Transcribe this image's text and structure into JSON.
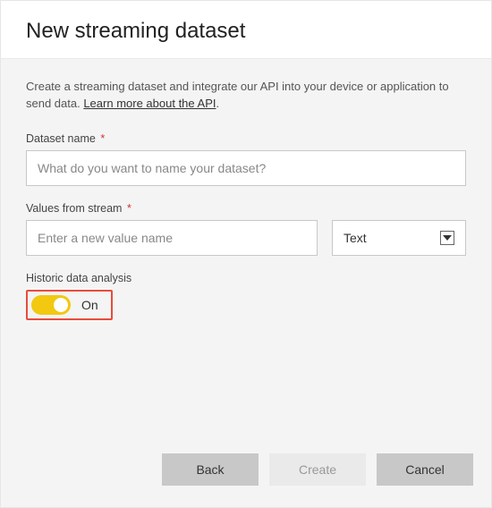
{
  "header": {
    "title": "New streaming dataset"
  },
  "intro": {
    "text_prefix": "Create a streaming dataset and integrate our API into your device or application to send data. ",
    "learn_more": "Learn more about the API",
    "text_suffix": "."
  },
  "fields": {
    "dataset_name": {
      "label": "Dataset name",
      "required_mark": "*",
      "placeholder": "What do you want to name your dataset?",
      "value": ""
    },
    "values_from_stream": {
      "label": "Values from stream",
      "required_mark": "*",
      "value_placeholder": "Enter a new value name",
      "value_input": "",
      "type_selected": "Text"
    },
    "historic": {
      "label": "Historic data analysis",
      "state_label": "On"
    }
  },
  "footer": {
    "back": "Back",
    "create": "Create",
    "cancel": "Cancel"
  }
}
